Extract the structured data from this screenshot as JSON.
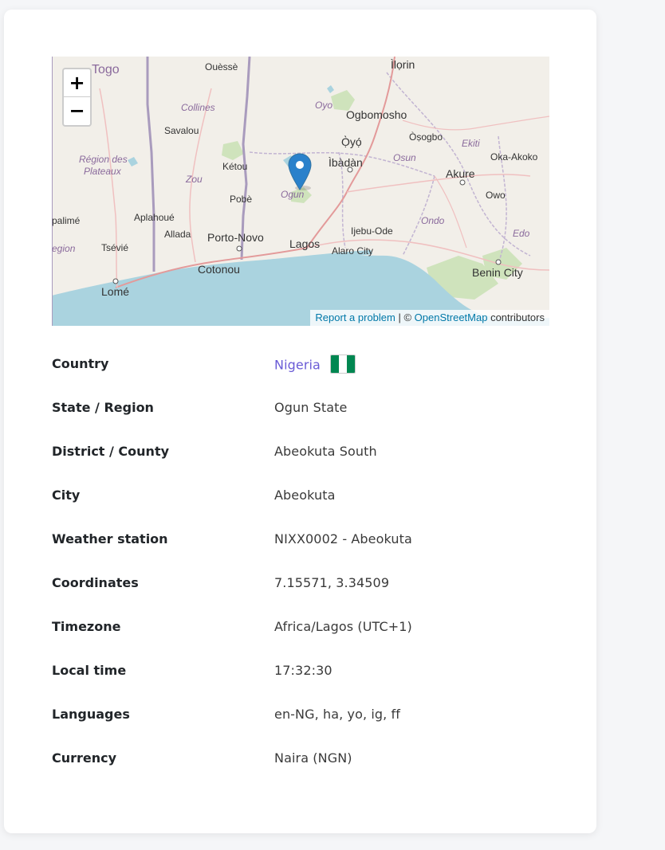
{
  "map": {
    "zoom_in_label": "+",
    "zoom_out_label": "−",
    "attribution": {
      "report_link": "Report a problem",
      "separator": " | © ",
      "osm_link": "OpenStreetMap",
      "suffix": " contributors"
    },
    "labels": {
      "togo": "Togo",
      "ouesse": "Ouèssè",
      "ilorin": "Ìlọrin",
      "collines": "Collines",
      "savalou": "Savalou",
      "oyo_region": "Oyo",
      "ogbomosho": "Ogbomosho",
      "oyo_city": "Ọ̀yọ́",
      "osogbo": "Òṣogbo",
      "ekiti": "Ekiti",
      "region_plateaux_1": "Région des",
      "region_plateaux_2": "Plateaux",
      "ketou": "Kétou",
      "ibadan": "Ìbàdàn",
      "osun": "Osun",
      "akure": "Akure",
      "oka_akoko": "Oka-Akoko",
      "zou": "Zou",
      "ogun": "Ogun",
      "owo": "Owo",
      "pobe": "Pobè",
      "palime": "palimé",
      "aplahoue": "Aplahoué",
      "ondo": "Ondo",
      "allada": "Allada",
      "porto_novo": "Porto-Novo",
      "lagos": "Lagos",
      "ijebu_ode": "Ijebu-Ode",
      "edo": "Edo",
      "egion": "egion",
      "tsevie": "Tsévié",
      "alaro_city": "Alaro City",
      "cotonou": "Cotonou",
      "benin_city": "Benin City",
      "lome": "Lomé"
    },
    "colors": {
      "land": "#f2efe9",
      "sea": "#aad3df",
      "boundary": "#9e8cb0",
      "road": "#e8a0a0",
      "green": "#c8e0b0"
    }
  },
  "info": {
    "rows": [
      {
        "label": "Country",
        "value": "Nigeria"
      },
      {
        "label": "State / Region",
        "value": "Ogun State"
      },
      {
        "label": "District / County",
        "value": "Abeokuta South"
      },
      {
        "label": "City",
        "value": "Abeokuta"
      },
      {
        "label": "Weather station",
        "value": "NIXX0002 - Abeokuta"
      },
      {
        "label": "Coordinates",
        "value": "7.15571, 3.34509"
      },
      {
        "label": "Timezone",
        "value": "Africa/Lagos (UTC+1)"
      },
      {
        "label": "Local time",
        "value": "17:32:30"
      },
      {
        "label": "Languages",
        "value": "en-NG, ha, yo, ig, ff"
      },
      {
        "label": "Currency",
        "value": "Naira (NGN)"
      }
    ],
    "flag_colors": {
      "green": "#008751",
      "white": "#ffffff"
    },
    "link_color": "#6a5bd6"
  }
}
